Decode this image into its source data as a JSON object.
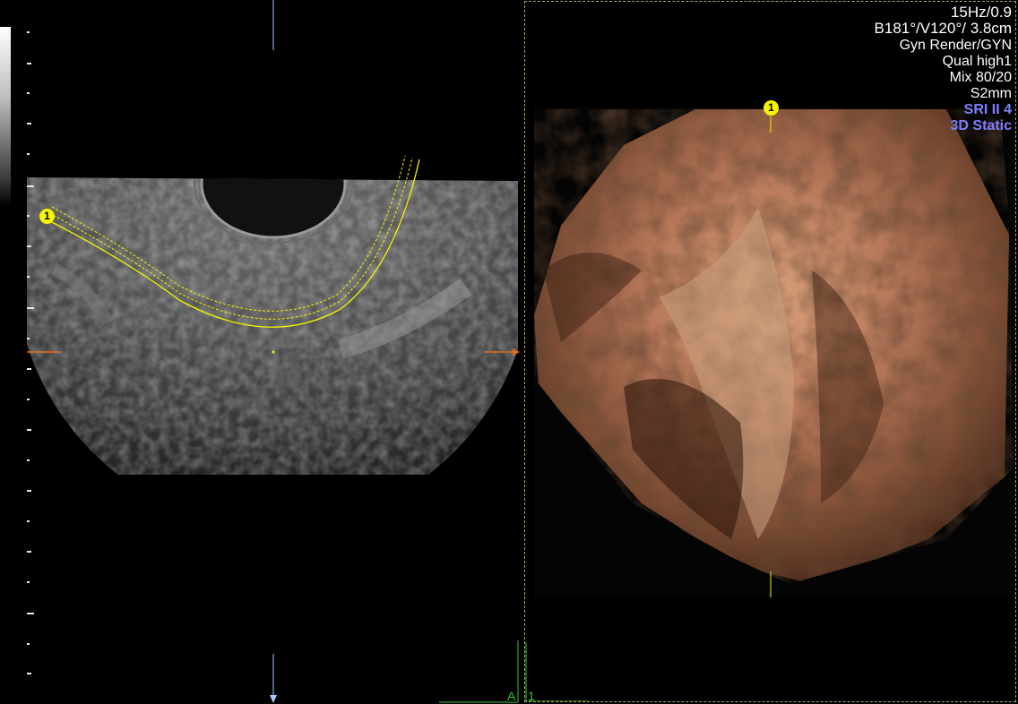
{
  "acquisition": {
    "frame_rate": "15Hz/0.9",
    "angles": "B181°/V120°/ 3.8cm",
    "render_mode": "Gyn Render/GYN",
    "quality": "Qual high1",
    "mix": "Mix 80/20",
    "slice": "S2mm",
    "sri": "SRI II 4",
    "mode": "3D Static"
  },
  "markers": {
    "left_marker": "1",
    "render_marker": "1"
  },
  "axis_labels": {
    "a": "A",
    "one": "1"
  },
  "colors": {
    "background": "#000000",
    "render_curve": "#f5f500",
    "mode_text": "#7f7fff",
    "axis_green": "#36c436",
    "volume_tint": "#c88a5e"
  }
}
